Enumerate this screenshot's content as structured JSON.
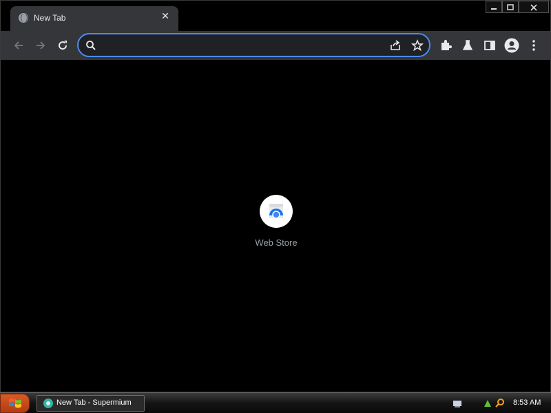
{
  "tab": {
    "title": "New Tab",
    "close": "✕"
  },
  "window_controls": {
    "minimize": "—",
    "maximize": "☐",
    "close": "X"
  },
  "toolbar": {
    "back": "back-arrow-icon",
    "forward": "forward-arrow-icon",
    "reload": "reload-icon"
  },
  "omnibox": {
    "value": "",
    "placeholder": ""
  },
  "shortcuts": [
    {
      "label": "Web Store"
    }
  ],
  "taskbar": {
    "task_label": "New Tab - Supermium",
    "clock": "8:53 AM"
  },
  "colors": {
    "accent": "#4d8bf5",
    "toolbar": "#35363a",
    "background": "#000000"
  }
}
